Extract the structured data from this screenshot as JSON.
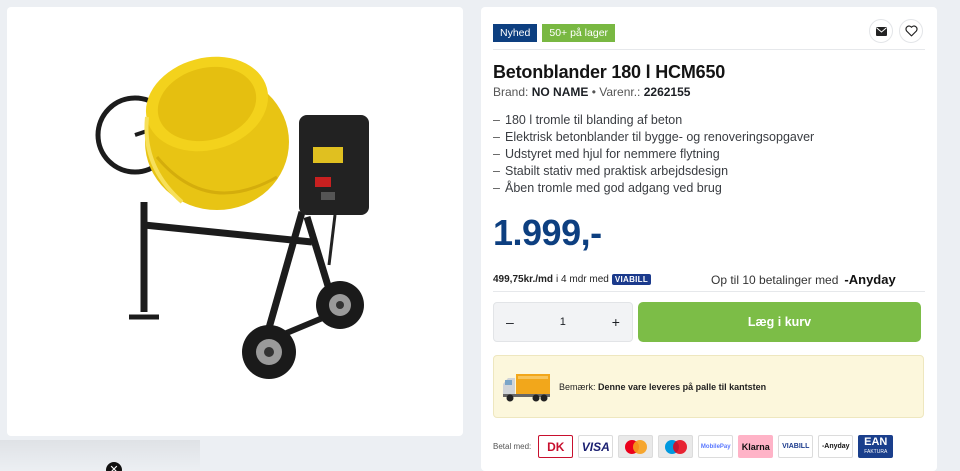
{
  "badges": {
    "new": "Nyhed",
    "stock": "50+ på lager"
  },
  "product": {
    "title": "Betonblander 180 l HCM650",
    "brand_label": "Brand:",
    "brand": "NO NAME",
    "sku_label": "• Varenr.:",
    "sku": "2262155",
    "features": [
      "180 l tromle til blanding af beton",
      "Elektrisk betonblander til bygge- og renoveringsopgaver",
      "Udstyret med hjul for nemmere flytning",
      "Stabilt stativ med praktisk arbejdsdesign",
      "Åben tromle med god adgang ved brug"
    ],
    "feature_dash": "–",
    "price": "1.999,-"
  },
  "finance": {
    "monthly": "499,75kr./md",
    "months_text": "i 4 mdr med",
    "viabill": "VIABILL",
    "anyday_text": "Op til 10 betalinger med",
    "anyday_logo": "-Anyday"
  },
  "cart": {
    "minus": "–",
    "plus": "+",
    "quantity": "1",
    "add_label": "Læg i kurv"
  },
  "notice": {
    "label": "Bemærk:",
    "text": "Denne vare leveres på palle til kantsten"
  },
  "payment": {
    "label": "Betal med:",
    "methods": [
      "DK",
      "VISA",
      "MasterCard",
      "Maestro",
      "MobilePay",
      "Klarna",
      "VIABILL",
      "-Anyday",
      "EAN",
      "FAKTURA"
    ]
  },
  "colors": {
    "brand_blue": "#0d3f80",
    "green": "#7cbd47",
    "mixer_yellow": "#f3d21c"
  },
  "icons": {
    "mail": "mail-icon",
    "heart": "heart-icon",
    "close": "close-icon",
    "truck": "truck-icon"
  }
}
